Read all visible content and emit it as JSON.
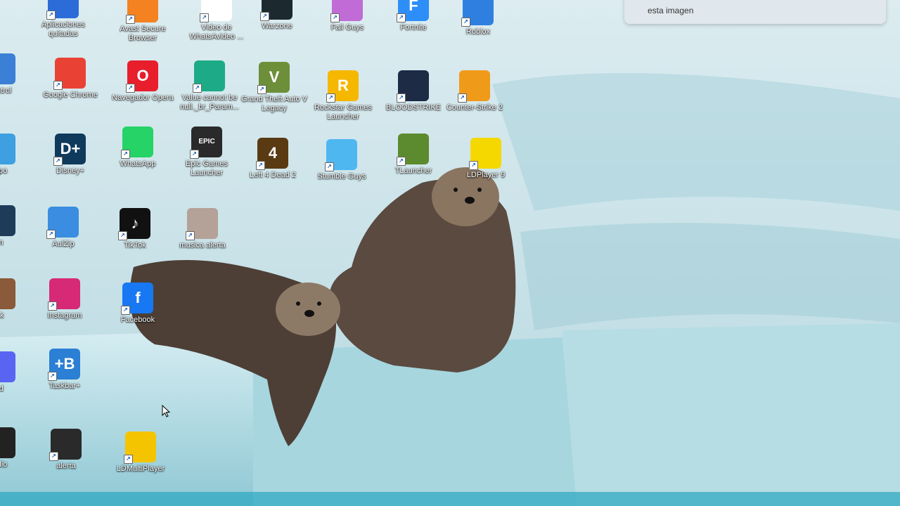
{
  "notification": {
    "text": "esta imagen"
  },
  "icons": [
    {
      "label": "Aplicaciones quitadas",
      "name": "aplicaciones-quitadas-icon",
      "color": "#2b6cd9",
      "glyph": ""
    },
    {
      "label": "Avast Secure Browser",
      "name": "avast-secure-browser-icon",
      "color": "#f58220",
      "glyph": ""
    },
    {
      "label": "Video de WhatsAvideo ...",
      "name": "video-file-icon",
      "color": "#ffffff",
      "glyph": ""
    },
    {
      "label": "Warzone",
      "name": "warzone-icon",
      "color": "#1c2a30",
      "glyph": ""
    },
    {
      "label": "Fall Guys",
      "name": "fall-guys-icon",
      "color": "#c06bd6",
      "glyph": ""
    },
    {
      "label": "Fortnite",
      "name": "fortnite-icon",
      "color": "#2e8ef7",
      "glyph": "F"
    },
    {
      "label": "Roblox",
      "name": "roblox-icon",
      "color": "#2f7fe0",
      "glyph": ""
    },
    {
      "label": "control",
      "name": "control-panel-icon",
      "color": "#3b7fd6",
      "glyph": ""
    },
    {
      "label": "Google Chrome",
      "name": "google-chrome-icon",
      "color": "#e94235",
      "glyph": ""
    },
    {
      "label": "Navegador Opera",
      "name": "opera-browser-icon",
      "color": "#e81e2d",
      "glyph": "O"
    },
    {
      "label": "Value cannot be null._br_Param...",
      "name": "microsoft-edge-icon",
      "color": "#1dab87",
      "glyph": ""
    },
    {
      "label": "Grand Theft Auto V Legacy",
      "name": "gta-v-icon",
      "color": "#6e8f3a",
      "glyph": "V"
    },
    {
      "label": "Rockstar Games Launcher",
      "name": "rockstar-launcher-icon",
      "color": "#f5b700",
      "glyph": "R"
    },
    {
      "label": "BLOODSTRIKE",
      "name": "bloodstrike-icon",
      "color": "#1d2b45",
      "glyph": ""
    },
    {
      "label": "Counter-Strike 2",
      "name": "counter-strike-2-icon",
      "color": "#f09a1a",
      "glyph": ""
    },
    {
      "label": "uipo",
      "name": "equipo-icon",
      "color": "#3ea0e0",
      "glyph": ""
    },
    {
      "label": "Disney+",
      "name": "disney-plus-icon",
      "color": "#0f3a5c",
      "glyph": "D+"
    },
    {
      "label": "WhatsApp",
      "name": "whatsapp-icon",
      "color": "#25d366",
      "glyph": ""
    },
    {
      "label": "Epic Games Launcher",
      "name": "epic-games-launcher-icon",
      "color": "#2a2a2a",
      "glyph": "EPIC"
    },
    {
      "label": "Left 4 Dead 2",
      "name": "left-4-dead-2-icon",
      "color": "#5a3a12",
      "glyph": "4"
    },
    {
      "label": "Stumble Guys",
      "name": "stumble-guys-icon",
      "color": "#4fb7f0",
      "glyph": ""
    },
    {
      "label": "TLauncher",
      "name": "tlauncher-icon",
      "color": "#5c8a2e",
      "glyph": ""
    },
    {
      "label": "LDPlayer 9",
      "name": "ldplayer-9-icon",
      "color": "#f5d800",
      "glyph": ""
    },
    {
      "label": "m",
      "name": "left-edge-app-icon",
      "color": "#1e3c5a",
      "glyph": ""
    },
    {
      "label": "AulZip",
      "name": "aulzip-icon",
      "color": "#3a8de0",
      "glyph": ""
    },
    {
      "label": "TikTok",
      "name": "tiktok-icon",
      "color": "#111111",
      "glyph": "♪"
    },
    {
      "label": "musica alerta",
      "name": "musica-alerta-icon",
      "color": "#b4a197",
      "glyph": ""
    },
    {
      "label": "ck",
      "name": "left-edge-bear-icon",
      "color": "#8a5a3a",
      "glyph": ""
    },
    {
      "label": "Instagram",
      "name": "instagram-icon",
      "color": "#d62976",
      "glyph": ""
    },
    {
      "label": "Facebook",
      "name": "facebook-icon",
      "color": "#1877f2",
      "glyph": "f"
    },
    {
      "label": "rd",
      "name": "left-edge-discord-icon",
      "color": "#5865f2",
      "glyph": ""
    },
    {
      "label": "Taskbar+",
      "name": "taskbar-plus-icon",
      "color": "#2b7fd4",
      "glyph": "+B"
    },
    {
      "label": "udio",
      "name": "left-edge-audio-icon",
      "color": "#222222",
      "glyph": ""
    },
    {
      "label": "alerta",
      "name": "alerta-video-icon",
      "color": "#2a2a2a",
      "glyph": ""
    },
    {
      "label": "LDMultiPlayer",
      "name": "ldmultiplayer-icon",
      "color": "#f5c400",
      "glyph": ""
    }
  ]
}
